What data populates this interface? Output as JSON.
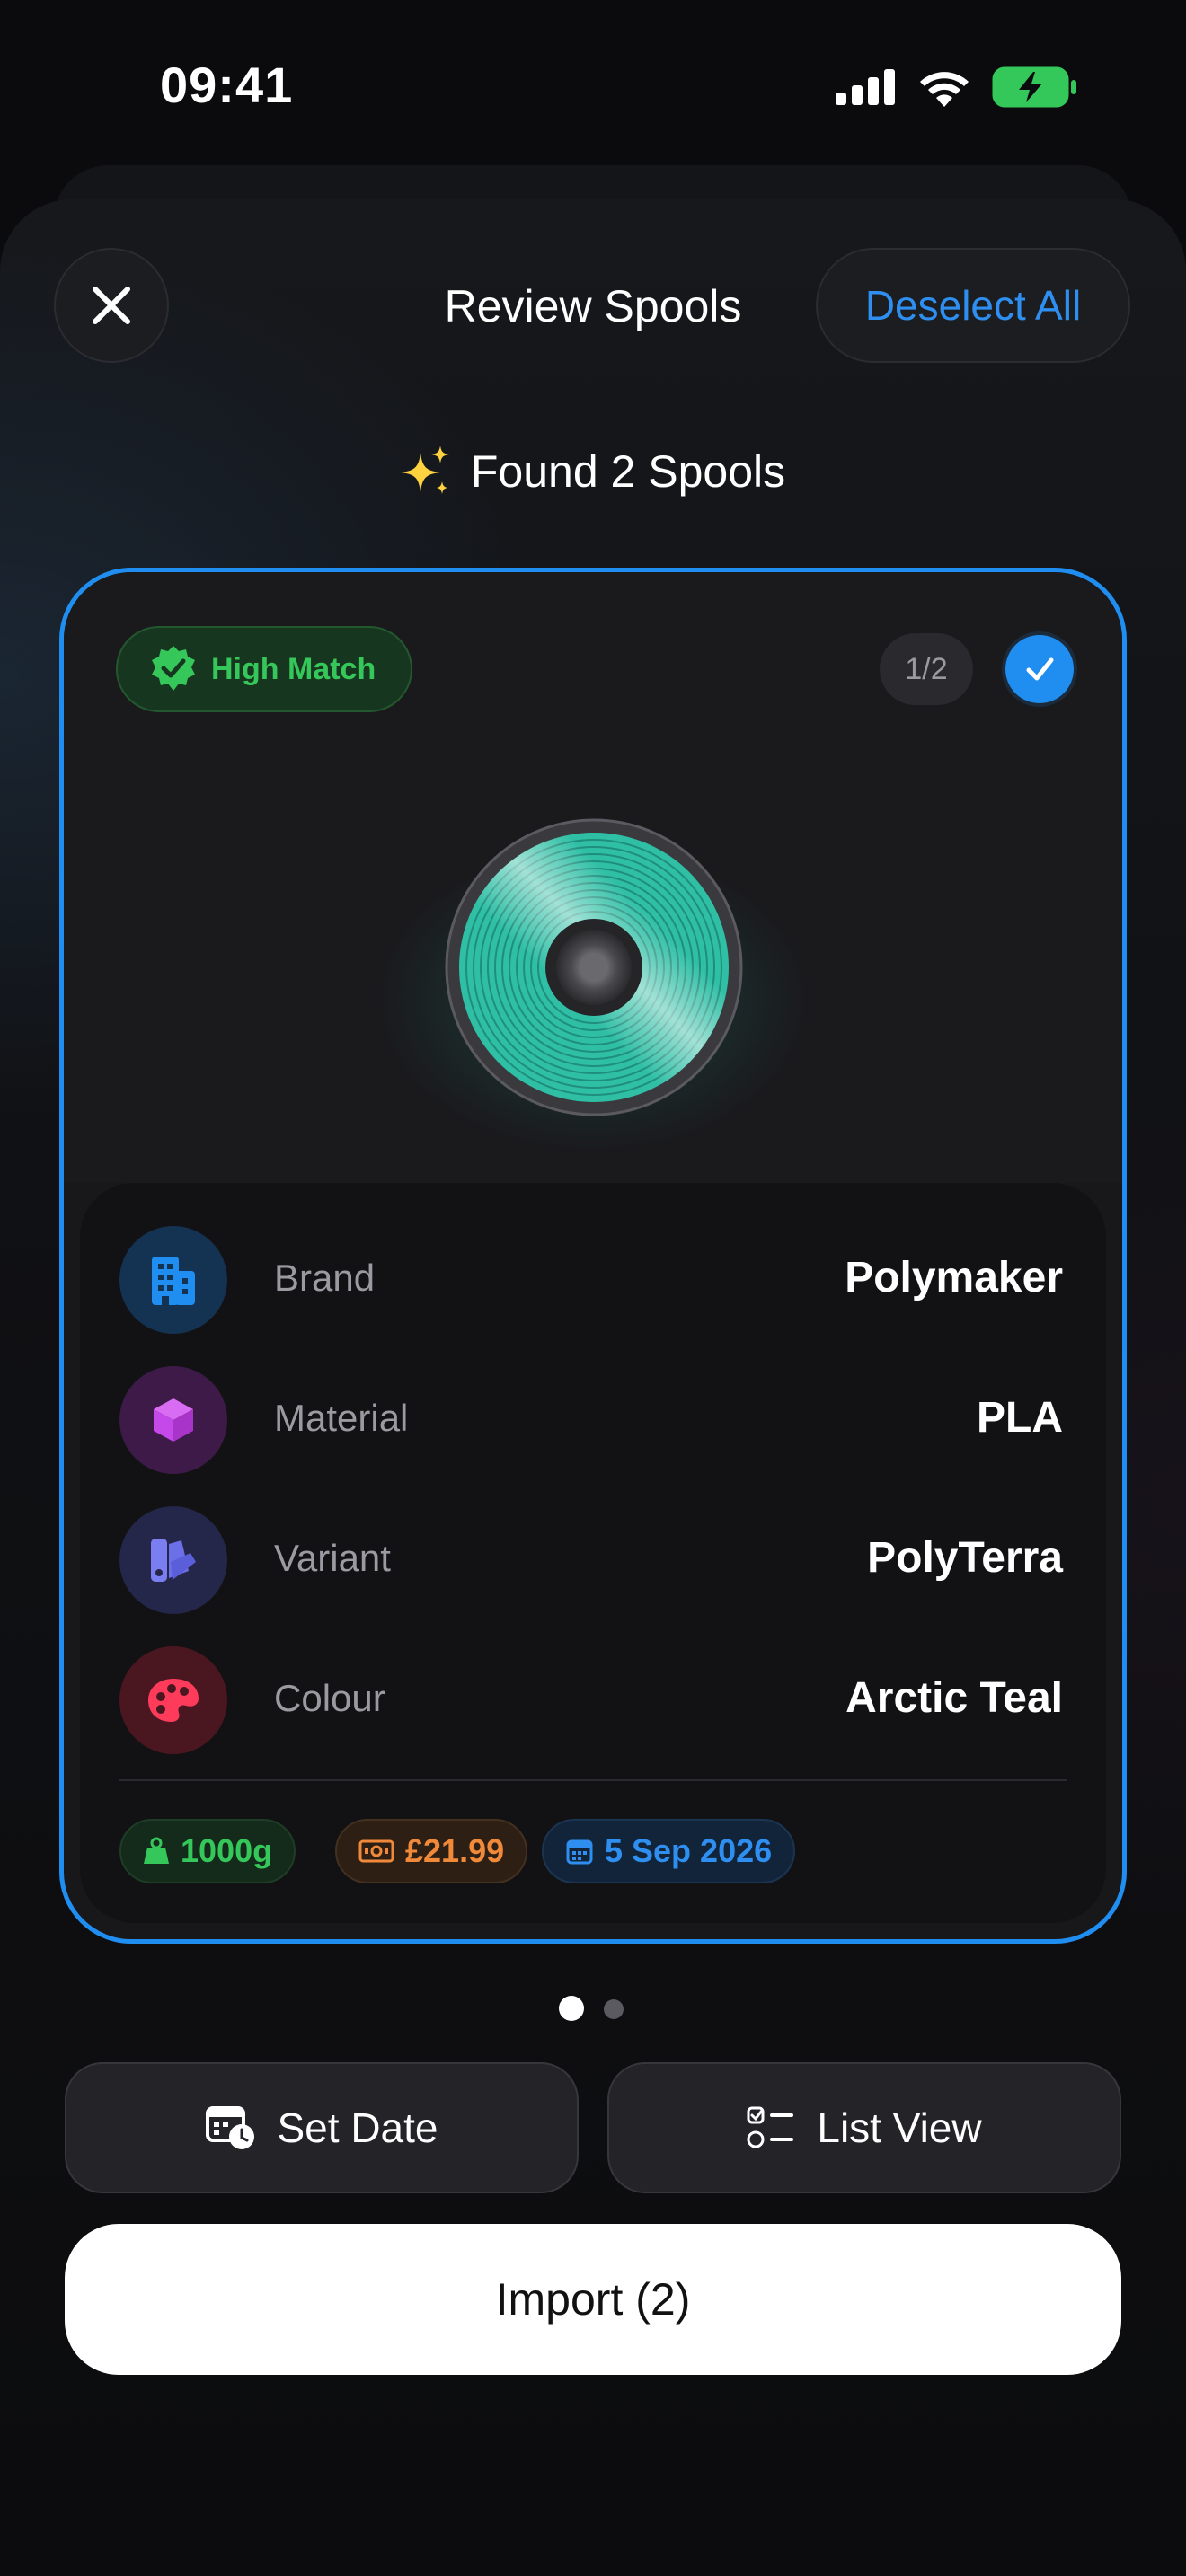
{
  "status_bar": {
    "time": "09:41"
  },
  "header": {
    "title": "Review Spools",
    "deselect_label": "Deselect All"
  },
  "found": {
    "text": "Found 2 Spools",
    "icon": "sparkles-icon"
  },
  "card": {
    "match_label": "High Match",
    "page_indicator": "1/2",
    "selected": true,
    "spool_color": "#2fbfa5",
    "rows": [
      {
        "label": "Brand",
        "value": "Polymaker",
        "icon": "building-icon",
        "icon_color": "#1f8ef0"
      },
      {
        "label": "Material",
        "value": "PLA",
        "icon": "cube-icon",
        "icon_color": "#c548e8"
      },
      {
        "label": "Variant",
        "value": "PolyTerra",
        "icon": "swatch-icon",
        "icon_color": "#6b6fe8"
      },
      {
        "label": "Colour",
        "value": "Arctic Teal",
        "icon": "palette-icon",
        "icon_color": "#ff3b5c"
      }
    ],
    "chips": {
      "weight": "1000g",
      "price": "£21.99",
      "date": "5 Sep 2026"
    }
  },
  "pagination": {
    "total": 2,
    "current": 1
  },
  "actions": {
    "set_date": "Set Date",
    "list_view": "List View",
    "import": "Import (2)"
  },
  "colors": {
    "accent": "#1f8ef0",
    "match_green": "#35c759",
    "price_orange": "#f08a3a"
  }
}
